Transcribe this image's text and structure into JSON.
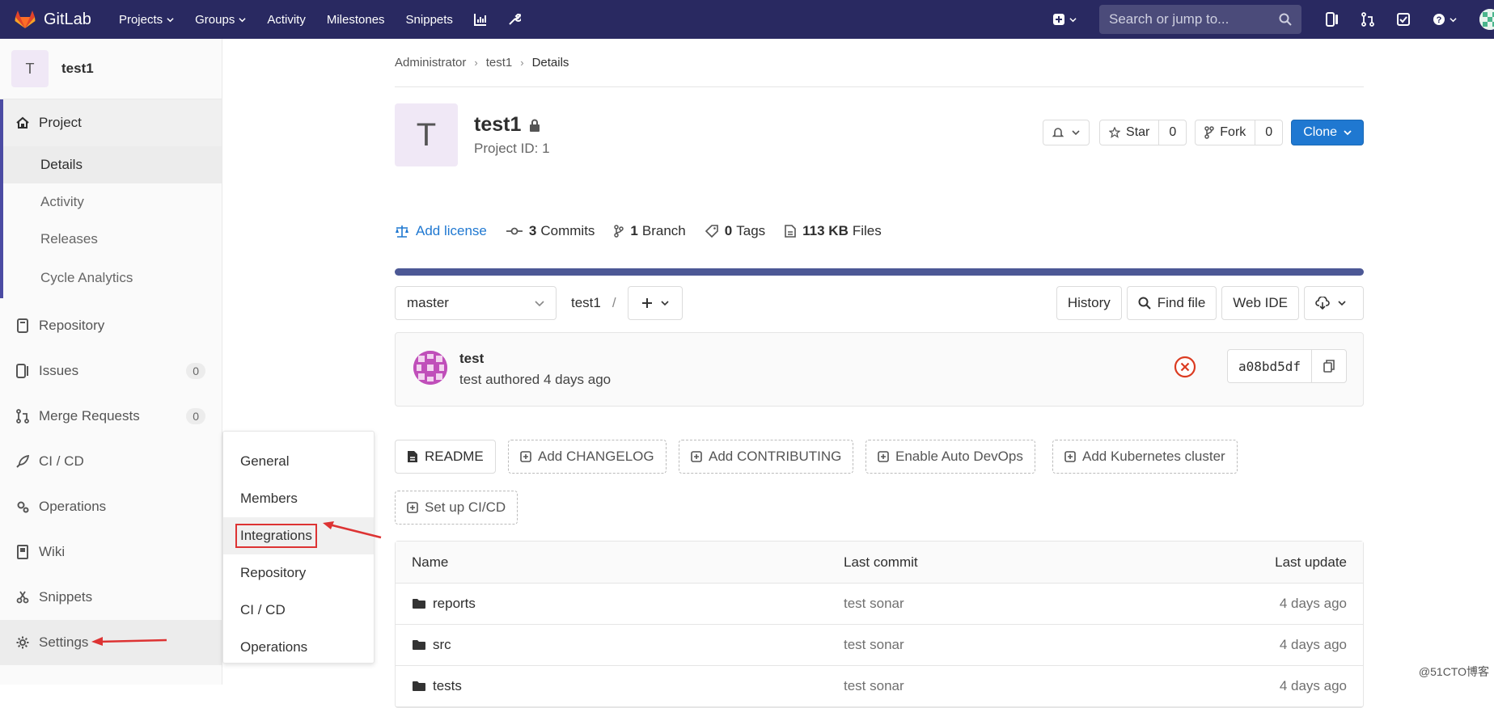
{
  "navbar": {
    "brand": "GitLab",
    "links": [
      "Projects",
      "Groups",
      "Activity",
      "Milestones",
      "Snippets"
    ],
    "search_placeholder": "Search or jump to..."
  },
  "sidebar": {
    "avatar_letter": "T",
    "project_name": "test1",
    "project_label": "Project",
    "project_subitems": [
      "Details",
      "Activity",
      "Releases",
      "Cycle Analytics"
    ],
    "items": [
      {
        "label": "Repository"
      },
      {
        "label": "Issues",
        "badge": "0"
      },
      {
        "label": "Merge Requests",
        "badge": "0"
      },
      {
        "label": "CI / CD"
      },
      {
        "label": "Operations"
      },
      {
        "label": "Wiki"
      },
      {
        "label": "Snippets"
      },
      {
        "label": "Settings"
      }
    ]
  },
  "flyout": {
    "items": [
      "General",
      "Members",
      "Integrations",
      "Repository",
      "CI / CD",
      "Operations"
    ]
  },
  "breadcrumb": [
    "Administrator",
    "test1",
    "Details"
  ],
  "project": {
    "avatar_letter": "T",
    "title": "test1",
    "project_id": "Project ID: 1",
    "star_label": "Star",
    "star_count": "0",
    "fork_label": "Fork",
    "fork_count": "0",
    "clone_label": "Clone"
  },
  "stats": {
    "license": "Add license",
    "commits_count": "3",
    "commits_label": "Commits",
    "branch_count": "1",
    "branch_label": "Branch",
    "tags_count": "0",
    "tags_label": "Tags",
    "files_size": "113 KB",
    "files_label": "Files"
  },
  "toolbar": {
    "branch": "master",
    "path": "test1",
    "slash": "/",
    "history": "History",
    "find_file": "Find file",
    "web_ide": "Web IDE"
  },
  "commit": {
    "title": "test",
    "meta": "test authored 4 days ago",
    "sha": "a08bd5df"
  },
  "quick_buttons": [
    "README",
    "Add CHANGELOG",
    "Add CONTRIBUTING",
    "Enable Auto DevOps",
    "Add Kubernetes cluster",
    "Set up CI/CD"
  ],
  "files": {
    "headers": [
      "Name",
      "Last commit",
      "Last update"
    ],
    "rows": [
      {
        "name": "reports",
        "commit": "test sonar",
        "updated": "4 days ago"
      },
      {
        "name": "src",
        "commit": "test sonar",
        "updated": "4 days ago"
      },
      {
        "name": "tests",
        "commit": "test sonar",
        "updated": "4 days ago"
      }
    ]
  },
  "watermark": "@51CTO博客",
  "colors": {
    "navbar": "#292961",
    "accent": "#4b4ba3",
    "link": "#1f78d1",
    "clone_button": "#1f78d1",
    "language_bar": "#4c5895",
    "annotation_red": "#d33"
  }
}
